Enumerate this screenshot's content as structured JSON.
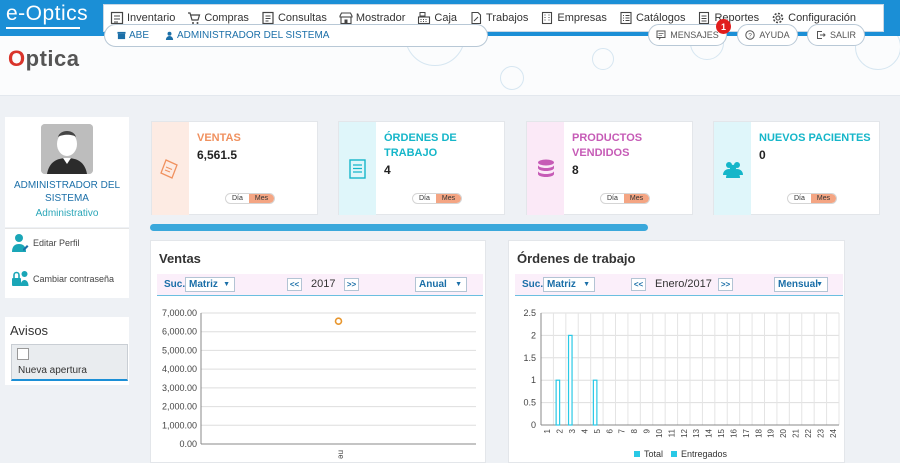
{
  "app": {
    "brand": "e-Optics",
    "logo": "ptica",
    "logo_o": "O"
  },
  "nav": [
    {
      "label": "Inventario",
      "icon": "inventory-icon"
    },
    {
      "label": "Compras",
      "icon": "cart-icon"
    },
    {
      "label": "Consultas",
      "icon": "consult-icon"
    },
    {
      "label": "Mostrador",
      "icon": "store-icon"
    },
    {
      "label": "Caja",
      "icon": "cash-register-icon"
    },
    {
      "label": "Trabajos",
      "icon": "jobs-icon"
    },
    {
      "label": "Empresas",
      "icon": "building-icon"
    },
    {
      "label": "Catálogos",
      "icon": "catalog-icon"
    },
    {
      "label": "Reportes",
      "icon": "report-icon"
    },
    {
      "label": "Configuración",
      "icon": "gear-icon"
    }
  ],
  "header": {
    "branch": "ABE",
    "user": "ADMINISTRADOR DEL SISTEMA",
    "messages_label": "MENSAJES",
    "messages_badge": "1",
    "help_label": "AYUDA",
    "logout_label": "SALIR"
  },
  "profile": {
    "name": "ADMINISTRADOR DEL SISTEMA",
    "role": "Administrativo",
    "edit_label": "Editar Perfil",
    "password_label": "Cambiar contraseña"
  },
  "avisos": {
    "title": "Avisos",
    "items": [
      {
        "label": "Nueva apertura"
      }
    ]
  },
  "stats": [
    {
      "label_1": "VENTAS",
      "label_2": "",
      "value": "6,561.5",
      "color": "#f0915f",
      "bg": "#fdebe3"
    },
    {
      "label_1": "ÓRDENES DE",
      "label_2": "TRABAJO",
      "value": "4",
      "color": "#15b6c9",
      "bg": "#dff6fa"
    },
    {
      "label_1": "PRODUCTOS",
      "label_2": "VENDIDOS",
      "value": "8",
      "color": "#c65bb6",
      "bg": "#fbe9f7"
    },
    {
      "label_1": "NUEVOS PACIENTES",
      "label_2": "",
      "value": "0",
      "color": "#15b6c9",
      "bg": "#dff6fa"
    }
  ],
  "toggle": {
    "day": "Día",
    "month": "Mes"
  },
  "ventas_panel": {
    "title": "Ventas",
    "suc_label": "Suc.",
    "branch_select": "Matriz",
    "prev": "<<",
    "period": "2017",
    "next": ">>",
    "range_select": "Anual"
  },
  "ordenes_panel": {
    "title": "Órdenes de trabajo",
    "suc_label": "Suc.",
    "branch_select": "Matriz",
    "prev": "<<",
    "period": "Enero/2017",
    "next": ">>",
    "range_select": "Mensual"
  },
  "chart_data": [
    {
      "type": "scatter",
      "title": "",
      "x": [
        "ne"
      ],
      "values": [
        6561.5
      ],
      "ylim": [
        0,
        7000
      ],
      "yticks": [
        "0.00",
        "1,000.00",
        "2,000.00",
        "3,000.00",
        "4,000.00",
        "5,000.00",
        "6,000.00",
        "7,000.00"
      ],
      "color": "#e8962e",
      "grid": true
    },
    {
      "type": "bar",
      "title": "",
      "categories": [
        "1",
        "2",
        "3",
        "4",
        "5",
        "6",
        "7",
        "8",
        "9",
        "10",
        "11",
        "12",
        "13",
        "14",
        "15",
        "16",
        "17",
        "18",
        "19",
        "20",
        "21",
        "22",
        "23",
        "24"
      ],
      "series": [
        {
          "name": "Total",
          "values": [
            0,
            1,
            2,
            0,
            1,
            0,
            0,
            0,
            0,
            0,
            0,
            0,
            0,
            0,
            0,
            0,
            0,
            0,
            0,
            0,
            0,
            0,
            0,
            0
          ]
        },
        {
          "name": "Entregados",
          "values": [
            0,
            0,
            0,
            0,
            0,
            0,
            0,
            0,
            0,
            0,
            0,
            0,
            0,
            0,
            0,
            0,
            0,
            0,
            0,
            0,
            0,
            0,
            0,
            0
          ]
        }
      ],
      "ylim": [
        0,
        2.5
      ],
      "yticks": [
        "0",
        "0.5",
        "1",
        "1.5",
        "2",
        "2.5"
      ],
      "color": "#29c9e6",
      "legend": "bottom",
      "grid": true
    }
  ]
}
